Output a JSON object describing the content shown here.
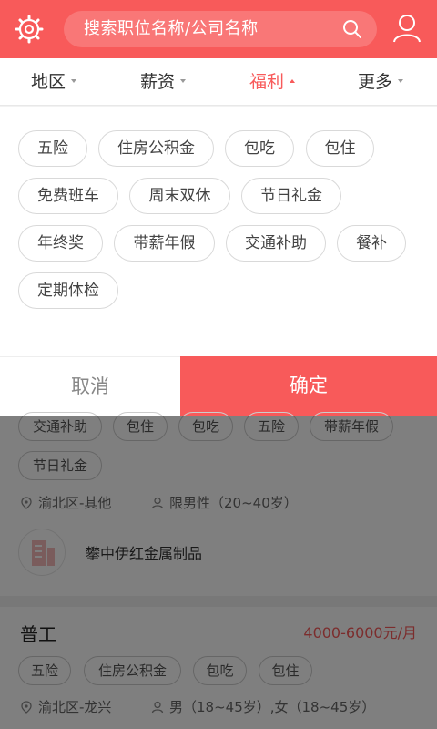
{
  "header": {
    "search_placeholder": "搜索职位名称/公司名称",
    "icons": [
      "settings-gear-icon",
      "search-icon",
      "user-profile-icon"
    ]
  },
  "filters": {
    "tabs": [
      {
        "label": "地区",
        "active": false
      },
      {
        "label": "薪资",
        "active": false
      },
      {
        "label": "福利",
        "active": true
      },
      {
        "label": "更多",
        "active": false
      }
    ]
  },
  "welfare": {
    "options": [
      "五险",
      "住房公积金",
      "包吃",
      "包住",
      "免费班车",
      "周末双休",
      "节日礼金",
      "年终奖",
      "带薪年假",
      "交通补助",
      "餐补",
      "定期体检"
    ]
  },
  "actions": {
    "cancel_label": "取消",
    "confirm_label": "确定"
  },
  "listing1": {
    "tags": [
      "交通补助",
      "包住",
      "包吃",
      "五险",
      "带薪年假",
      "节日礼金"
    ],
    "location": "渝北区-其他",
    "requirement": "限男性（20~40岁）",
    "company": "攀中伊红金属制品"
  },
  "listing2": {
    "title": "普工",
    "salary": "4000-6000元/月",
    "tags": [
      "五险",
      "住房公积金",
      "包吃",
      "包住"
    ],
    "location": "渝北区-龙兴",
    "requirement": "男（18~45岁）,女（18~45岁）"
  },
  "colors": {
    "accent": "#f85a5a",
    "overlay": "rgba(0,0,0,0.5)"
  }
}
